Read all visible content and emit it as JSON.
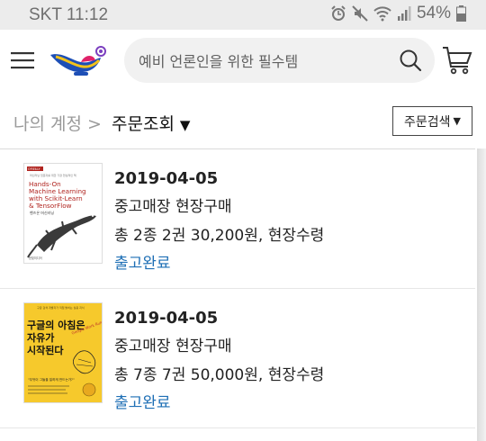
{
  "status_bar": {
    "carrier": "SKT",
    "time": "11:12",
    "battery": "54%"
  },
  "header": {
    "search_placeholder": "예비 언론인을 위한 필수템"
  },
  "breadcrumb": {
    "parent": "나의 계정 >",
    "current": "주문조회",
    "order_search": "주문검색"
  },
  "books": {
    "book1": {
      "top_tag": "O'REILLY",
      "tiny_text": "머신러닝 입문자를 위한 가장 현실적인 책",
      "title_lines": [
        "Hands-On",
        "Machine Learning",
        "with Scikit-Learn",
        "& TensorFlow"
      ],
      "subtitle": "핸즈온 머신러닝",
      "publisher": "한빛미디어"
    },
    "book2": {
      "tiny_text": "구글 검색 개발자가 직접 밝히는 실용 지식",
      "title_lines": [
        "구글의 아침은",
        "자유가",
        "시작된다"
      ],
      "english": "Google Work Rules!",
      "quote": "\"무엇이 그들을 일하게 만드는가?\""
    }
  },
  "orders": [
    {
      "date": "2019-04-05",
      "store": "중고매장 현장구매",
      "summary": "총 2종 2권 30,200원, 현장수령",
      "status": "출고완료"
    },
    {
      "date": "2019-04-05",
      "store": "중고매장 현장구매",
      "summary": "총 7종 7권 50,000원, 현장수령",
      "status": "출고완료"
    }
  ],
  "colors": {
    "status_link": "#1e6fb5",
    "book1_cover": "#ffffff",
    "book1_accent": "#b0231e",
    "book2_cover": "#f6c92c"
  }
}
